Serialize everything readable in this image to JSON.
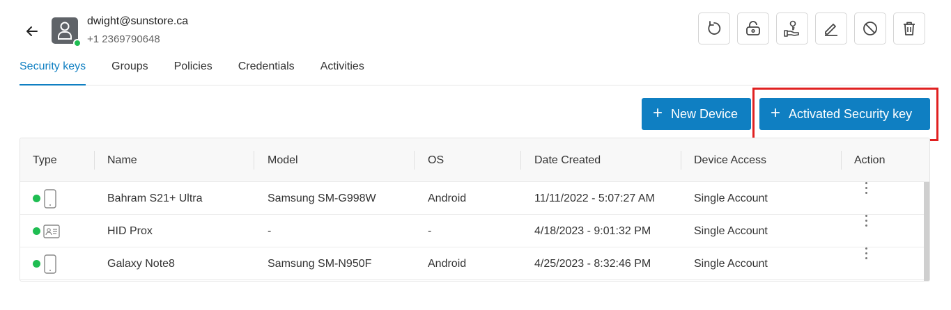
{
  "header": {
    "email": "dwight@sunstore.ca",
    "phone": "+1 2369790648",
    "avatar_status": "online",
    "status_color": "#1fbd52"
  },
  "toolbar": {
    "actions": [
      {
        "icon": "refresh-icon"
      },
      {
        "icon": "unlock-icon"
      },
      {
        "icon": "hand-key-icon"
      },
      {
        "icon": "edit-icon"
      },
      {
        "icon": "block-icon"
      },
      {
        "icon": "trash-icon"
      }
    ]
  },
  "tabs": [
    {
      "label": "Security keys",
      "active": true
    },
    {
      "label": "Groups",
      "active": false
    },
    {
      "label": "Policies",
      "active": false
    },
    {
      "label": "Credentials",
      "active": false
    },
    {
      "label": "Activities",
      "active": false
    }
  ],
  "buttons": {
    "new_device": "New Device",
    "activated_key": "Activated Security key",
    "accent_color": "#0f7fc2"
  },
  "table": {
    "columns": [
      "Type",
      "Name",
      "Model",
      "OS",
      "Date Created",
      "Device Access",
      "Action"
    ],
    "rows": [
      {
        "type_icon": "phone-icon",
        "name": "Bahram S21+ Ultra",
        "model": "Samsung SM-G998W",
        "os": "Android",
        "date": "11/11/2022 - 5:07:27 AM",
        "access": "Single Account"
      },
      {
        "type_icon": "id-card-icon",
        "name": "HID Prox",
        "model": "-",
        "os": "-",
        "date": "4/18/2023 - 9:01:32 PM",
        "access": "Single Account"
      },
      {
        "type_icon": "phone-icon",
        "name": "Galaxy Note8",
        "model": "Samsung SM-N950F",
        "os": "Android",
        "date": "4/25/2023 - 8:32:46 PM",
        "access": "Single Account"
      }
    ]
  }
}
